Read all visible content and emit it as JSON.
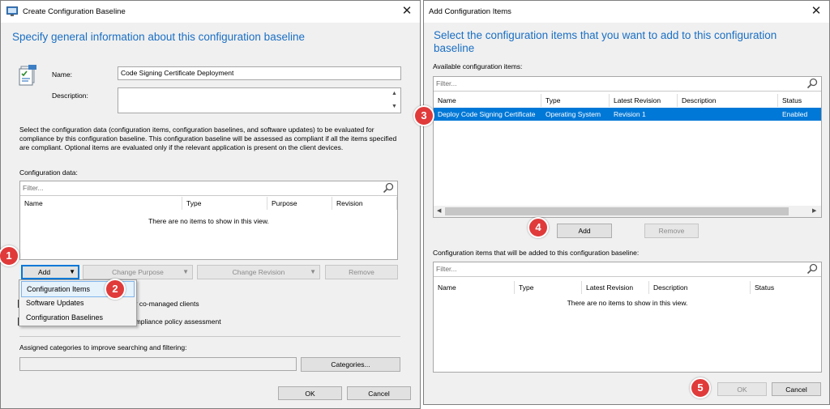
{
  "left_dialog": {
    "title": "Create Configuration Baseline",
    "heading": "Specify general information about this configuration baseline",
    "name_label": "Name:",
    "name_value": "Code Signing Certificate Deployment",
    "description_label": "Description:",
    "description_value": "",
    "info_text": "Select the configuration data (configuration items, configuration baselines, and software updates) to be evaluated for compliance by this configuration baseline. This configuration baseline will be assessed as compliant if all the items specified are compliant. Optional items are evaluated only if the relevant application is present on  the client devices.",
    "config_data_label": "Configuration data:",
    "filter_placeholder": "Filter...",
    "columns": [
      "Name",
      "Type",
      "Purpose",
      "Revision"
    ],
    "empty_text": "There are no items to show in this view.",
    "add_label": "Add",
    "change_purpose_label": "Change Purpose",
    "change_revision_label": "Change Revision",
    "remove_label": "Remove",
    "checkbox1_text": "or co-managed clients",
    "checkbox2_text": "ompliance policy assessment",
    "categories_label": "Assigned categories to improve searching and filtering:",
    "categories_value": "",
    "categories_button": "Categories...",
    "ok_label": "OK",
    "cancel_label": "Cancel",
    "add_menu": [
      "Configuration Items",
      "Software Updates",
      "Configuration Baselines"
    ]
  },
  "right_dialog": {
    "title": "Add Configuration Items",
    "heading": "Select the configuration items that you want to add to this configuration baseline",
    "available_label": "Available configuration items:",
    "filter_placeholder": "Filter...",
    "available_columns": [
      "Name",
      "Type",
      "Latest Revision",
      "Description",
      "Status"
    ],
    "available_rows": [
      {
        "name": "Deploy Code Signing Certificate",
        "type": "Operating System",
        "revision": "Revision 1",
        "description": "",
        "status": "Enabled"
      }
    ],
    "add_label": "Add",
    "remove_label": "Remove",
    "selected_label": "Configuration items that will be added to this configuration baseline:",
    "selected_columns": [
      "Name",
      "Type",
      "Latest Revision",
      "Description",
      "Status"
    ],
    "empty_text": "There are no items to show in this view.",
    "ok_label": "OK",
    "cancel_label": "Cancel"
  },
  "badges": [
    "1",
    "2",
    "3",
    "4",
    "5"
  ],
  "colors": {
    "accent": "#1a6fc4",
    "selection": "#0078d7",
    "badge": "#e03a3a"
  },
  "icons": [
    "baseline-icon",
    "search-icon",
    "close-icon",
    "dropdown-arrow-icon",
    "scroll-left-icon",
    "scroll-right-icon",
    "scroll-up-icon",
    "scroll-down-icon"
  ]
}
